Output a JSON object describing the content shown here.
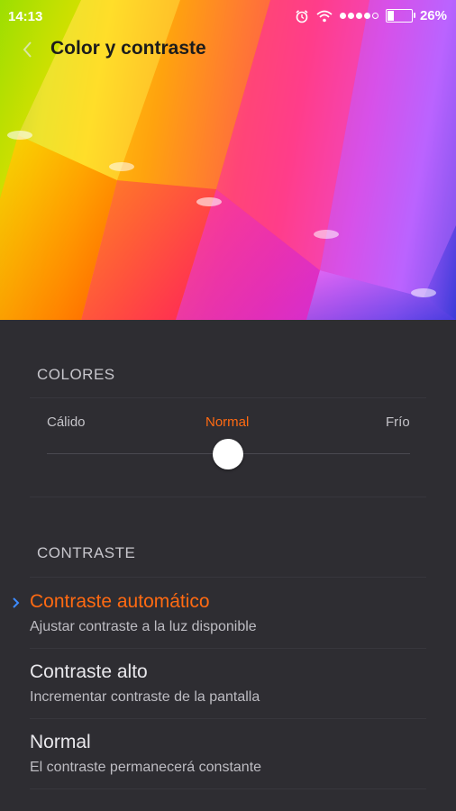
{
  "status": {
    "time": "14:13",
    "battery_percent": "26%",
    "battery_level": 0.26,
    "icons": [
      "alarm-icon",
      "wifi-icon",
      "signal-icon",
      "battery-icon"
    ]
  },
  "header": {
    "title": "Color y contraste",
    "back_icon": "chevron-left-icon"
  },
  "colores": {
    "section_label": "COLORES",
    "labels": {
      "warm": "Cálido",
      "normal": "Normal",
      "cold": "Frío"
    },
    "selected": "normal",
    "slider_value": 0.5
  },
  "contraste": {
    "section_label": "CONTRASTE",
    "options": [
      {
        "title": "Contraste automático",
        "subtitle": "Ajustar contraste a la luz disponible",
        "selected": true
      },
      {
        "title": "Contraste alto",
        "subtitle": "Incrementar contraste de la pantalla",
        "selected": false
      },
      {
        "title": "Normal",
        "subtitle": "El contraste permanecerá constante",
        "selected": false
      }
    ]
  },
  "colors": {
    "accent": "#ff6a12",
    "check": "#3d8bff",
    "background": "#2e2d32"
  }
}
